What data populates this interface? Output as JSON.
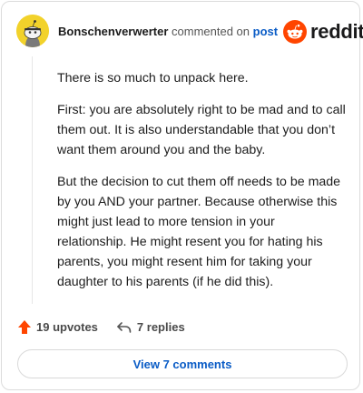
{
  "comment": {
    "username": "Bonschenverwerter",
    "action_text": "commented on",
    "post_link": "post",
    "paragraphs": [
      "There is so much to unpack here.",
      "First: you are absolutely right to be mad and to call them out. It is also understandable that you don’t want them around you and the baby.",
      "But the decision to cut them off needs to be made by you AND your partner. Because otherwise this might just lead to more tension in your relationship. He might resent you for hating his parents, you might resent him for taking your daughter to his parents (if he did this)."
    ],
    "upvotes_label": "19 upvotes",
    "replies_label": "7 replies",
    "view_comments_label": "View 7 comments"
  },
  "brand": {
    "logo_text": "reddit",
    "accent": "#ff4500",
    "link_color": "#0a5cc6"
  },
  "icons": {
    "avatar": "snoo-avatar",
    "logo": "reddit-logo-icon",
    "upvote": "upvote-arrow-icon",
    "reply": "reply-arrow-icon"
  }
}
